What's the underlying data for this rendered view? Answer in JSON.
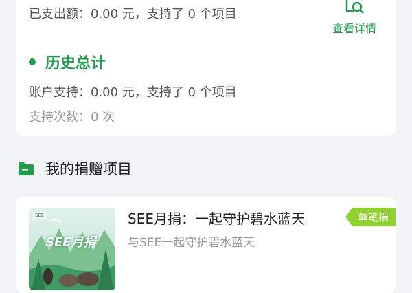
{
  "summary": {
    "spent_line": "已支出额：0.00 元，支持了 0 个项目",
    "view_details_label": "查看详情",
    "history_title": "历史总计",
    "account_line": "账户支持：0.00 元，支持了 0 个项目",
    "times_line": "支持次数：0 次"
  },
  "my_projects": {
    "title": "我的捐赠项目",
    "items": [
      {
        "title": "SEE月捐：一起守护碧水蓝天",
        "subtitle": "与SEE一起守护碧水蓝天",
        "badge": "单笔捐",
        "thumb_text": "SEE月捐",
        "thumb_logo": "SEE"
      }
    ]
  },
  "colors": {
    "accent": "#1f9d4c",
    "badge": "#8fd22f",
    "background": "#f2f3f5"
  },
  "icons": {
    "view_details": "search-document-icon",
    "section_marker": "green-dot-icon",
    "my_projects": "folder-icon"
  }
}
